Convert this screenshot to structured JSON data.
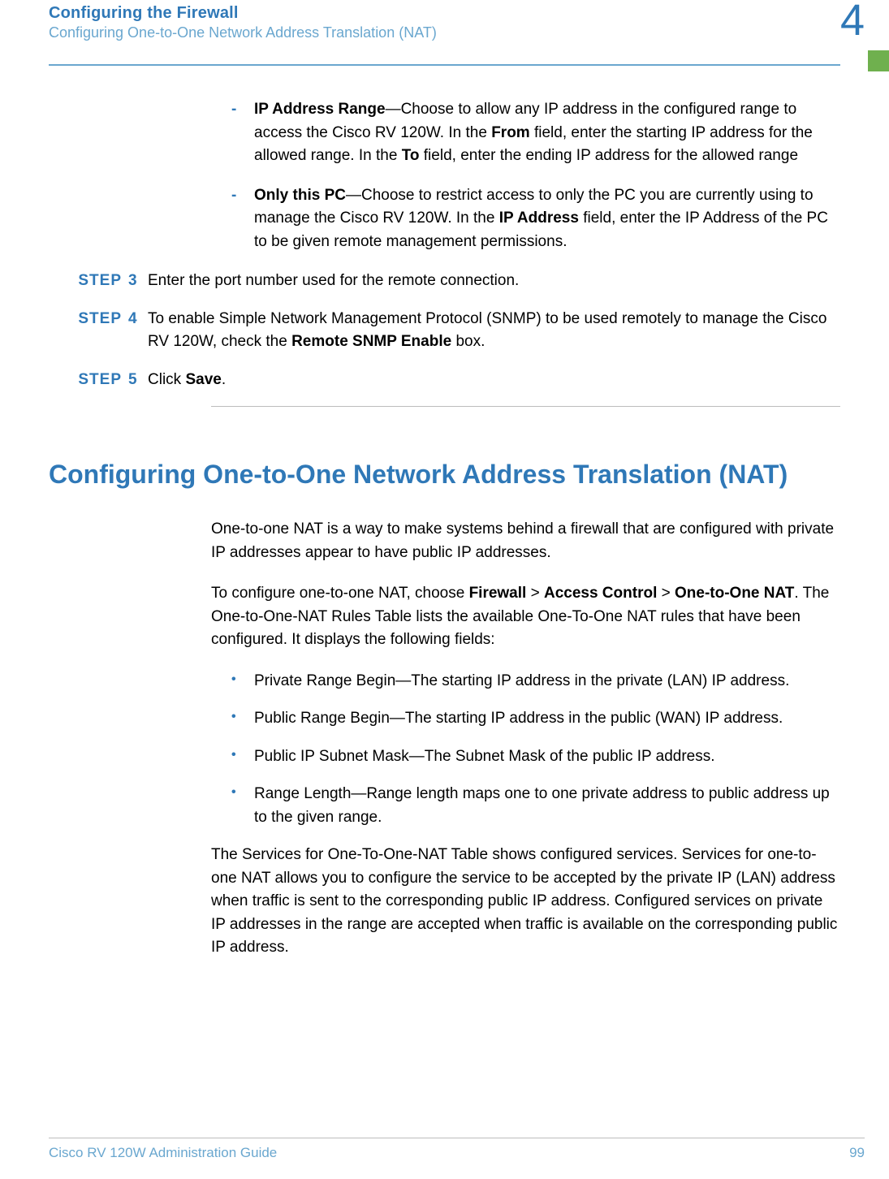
{
  "header": {
    "title": "Configuring the Firewall",
    "subtitle": "Configuring One-to-One Network Address Translation (NAT)",
    "chapter_num": "4"
  },
  "sub_bullets": [
    {
      "lead": "IP Address Range",
      "rest": "—Choose to allow any IP address in the configured range to access the Cisco RV 120W. In the ",
      "b1": "From",
      "mid1": " field, enter the starting IP address for the allowed range. In the ",
      "b2": "To",
      "mid2": " field, enter the ending IP address for the allowed range"
    },
    {
      "lead": "Only this PC",
      "rest": "—Choose to restrict access to only the PC you are currently using to manage the Cisco RV 120W. In the ",
      "b1": "IP Address",
      "mid1": " field, enter the IP Address of the PC to be given remote management permissions.",
      "b2": "",
      "mid2": ""
    }
  ],
  "steps": [
    {
      "label": "STEP",
      "num": "3",
      "pre": "Enter the port number used for the remote connection.",
      "b1": "",
      "mid": "",
      "b2": "",
      "post": ""
    },
    {
      "label": "STEP",
      "num": "4",
      "pre": "To enable Simple Network Management Protocol (SNMP) to be used remotely to manage the Cisco RV 120W, check the ",
      "b1": "Remote SNMP Enable",
      "mid": " box.",
      "b2": "",
      "post": ""
    },
    {
      "label": "STEP",
      "num": "5",
      "pre": "Click ",
      "b1": "Save",
      "mid": ".",
      "b2": "",
      "post": ""
    }
  ],
  "section_heading": "Configuring One-to-One Network Address Translation (NAT)",
  "para1": "One-to-one NAT is a way to make systems behind a firewall that are configured with private IP addresses appear to have public IP addresses.",
  "para2": {
    "pre": "To configure one-to-one NAT, choose ",
    "b1": "Firewall",
    "sep1": " > ",
    "b2": "Access Control",
    "sep2": " > ",
    "b3": "One-to-One NAT",
    "post": ". The One-to-One-NAT Rules Table lists the available One-To-One NAT rules that have been configured. It displays the following fields:"
  },
  "bullets": [
    "Private Range Begin—The starting IP address in the private (LAN) IP address.",
    "Public Range Begin—The starting IP address in the public (WAN) IP address.",
    "Public IP Subnet Mask—The Subnet Mask of the public IP address.",
    "Range Length—Range length maps one to one private address to public address up to the given range."
  ],
  "para3": "The Services for One-To-One-NAT Table shows configured services. Services for one-to-one NAT allows you to configure the service to be accepted by the private IP (LAN) address when traffic is sent to the corresponding public IP address. Configured services on private IP addresses in the range are accepted when traffic is available on the corresponding public IP address.",
  "footer": {
    "guide": "Cisco RV 120W Administration Guide",
    "page": "99"
  }
}
